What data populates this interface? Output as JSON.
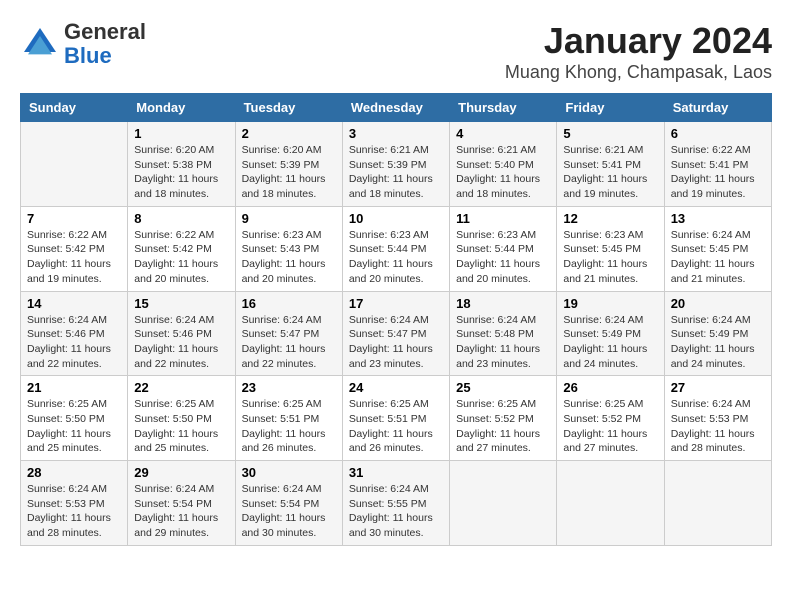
{
  "header": {
    "logo_general": "General",
    "logo_blue": "Blue",
    "title": "January 2024",
    "subtitle": "Muang Khong, Champasak, Laos"
  },
  "columns": [
    "Sunday",
    "Monday",
    "Tuesday",
    "Wednesday",
    "Thursday",
    "Friday",
    "Saturday"
  ],
  "weeks": [
    [
      {
        "day": "",
        "sunrise": "",
        "sunset": "",
        "daylight": ""
      },
      {
        "day": "1",
        "sunrise": "Sunrise: 6:20 AM",
        "sunset": "Sunset: 5:38 PM",
        "daylight": "Daylight: 11 hours and 18 minutes."
      },
      {
        "day": "2",
        "sunrise": "Sunrise: 6:20 AM",
        "sunset": "Sunset: 5:39 PM",
        "daylight": "Daylight: 11 hours and 18 minutes."
      },
      {
        "day": "3",
        "sunrise": "Sunrise: 6:21 AM",
        "sunset": "Sunset: 5:39 PM",
        "daylight": "Daylight: 11 hours and 18 minutes."
      },
      {
        "day": "4",
        "sunrise": "Sunrise: 6:21 AM",
        "sunset": "Sunset: 5:40 PM",
        "daylight": "Daylight: 11 hours and 18 minutes."
      },
      {
        "day": "5",
        "sunrise": "Sunrise: 6:21 AM",
        "sunset": "Sunset: 5:41 PM",
        "daylight": "Daylight: 11 hours and 19 minutes."
      },
      {
        "day": "6",
        "sunrise": "Sunrise: 6:22 AM",
        "sunset": "Sunset: 5:41 PM",
        "daylight": "Daylight: 11 hours and 19 minutes."
      }
    ],
    [
      {
        "day": "7",
        "sunrise": "Sunrise: 6:22 AM",
        "sunset": "Sunset: 5:42 PM",
        "daylight": "Daylight: 11 hours and 19 minutes."
      },
      {
        "day": "8",
        "sunrise": "Sunrise: 6:22 AM",
        "sunset": "Sunset: 5:42 PM",
        "daylight": "Daylight: 11 hours and 20 minutes."
      },
      {
        "day": "9",
        "sunrise": "Sunrise: 6:23 AM",
        "sunset": "Sunset: 5:43 PM",
        "daylight": "Daylight: 11 hours and 20 minutes."
      },
      {
        "day": "10",
        "sunrise": "Sunrise: 6:23 AM",
        "sunset": "Sunset: 5:44 PM",
        "daylight": "Daylight: 11 hours and 20 minutes."
      },
      {
        "day": "11",
        "sunrise": "Sunrise: 6:23 AM",
        "sunset": "Sunset: 5:44 PM",
        "daylight": "Daylight: 11 hours and 20 minutes."
      },
      {
        "day": "12",
        "sunrise": "Sunrise: 6:23 AM",
        "sunset": "Sunset: 5:45 PM",
        "daylight": "Daylight: 11 hours and 21 minutes."
      },
      {
        "day": "13",
        "sunrise": "Sunrise: 6:24 AM",
        "sunset": "Sunset: 5:45 PM",
        "daylight": "Daylight: 11 hours and 21 minutes."
      }
    ],
    [
      {
        "day": "14",
        "sunrise": "Sunrise: 6:24 AM",
        "sunset": "Sunset: 5:46 PM",
        "daylight": "Daylight: 11 hours and 22 minutes."
      },
      {
        "day": "15",
        "sunrise": "Sunrise: 6:24 AM",
        "sunset": "Sunset: 5:46 PM",
        "daylight": "Daylight: 11 hours and 22 minutes."
      },
      {
        "day": "16",
        "sunrise": "Sunrise: 6:24 AM",
        "sunset": "Sunset: 5:47 PM",
        "daylight": "Daylight: 11 hours and 22 minutes."
      },
      {
        "day": "17",
        "sunrise": "Sunrise: 6:24 AM",
        "sunset": "Sunset: 5:47 PM",
        "daylight": "Daylight: 11 hours and 23 minutes."
      },
      {
        "day": "18",
        "sunrise": "Sunrise: 6:24 AM",
        "sunset": "Sunset: 5:48 PM",
        "daylight": "Daylight: 11 hours and 23 minutes."
      },
      {
        "day": "19",
        "sunrise": "Sunrise: 6:24 AM",
        "sunset": "Sunset: 5:49 PM",
        "daylight": "Daylight: 11 hours and 24 minutes."
      },
      {
        "day": "20",
        "sunrise": "Sunrise: 6:24 AM",
        "sunset": "Sunset: 5:49 PM",
        "daylight": "Daylight: 11 hours and 24 minutes."
      }
    ],
    [
      {
        "day": "21",
        "sunrise": "Sunrise: 6:25 AM",
        "sunset": "Sunset: 5:50 PM",
        "daylight": "Daylight: 11 hours and 25 minutes."
      },
      {
        "day": "22",
        "sunrise": "Sunrise: 6:25 AM",
        "sunset": "Sunset: 5:50 PM",
        "daylight": "Daylight: 11 hours and 25 minutes."
      },
      {
        "day": "23",
        "sunrise": "Sunrise: 6:25 AM",
        "sunset": "Sunset: 5:51 PM",
        "daylight": "Daylight: 11 hours and 26 minutes."
      },
      {
        "day": "24",
        "sunrise": "Sunrise: 6:25 AM",
        "sunset": "Sunset: 5:51 PM",
        "daylight": "Daylight: 11 hours and 26 minutes."
      },
      {
        "day": "25",
        "sunrise": "Sunrise: 6:25 AM",
        "sunset": "Sunset: 5:52 PM",
        "daylight": "Daylight: 11 hours and 27 minutes."
      },
      {
        "day": "26",
        "sunrise": "Sunrise: 6:25 AM",
        "sunset": "Sunset: 5:52 PM",
        "daylight": "Daylight: 11 hours and 27 minutes."
      },
      {
        "day": "27",
        "sunrise": "Sunrise: 6:24 AM",
        "sunset": "Sunset: 5:53 PM",
        "daylight": "Daylight: 11 hours and 28 minutes."
      }
    ],
    [
      {
        "day": "28",
        "sunrise": "Sunrise: 6:24 AM",
        "sunset": "Sunset: 5:53 PM",
        "daylight": "Daylight: 11 hours and 28 minutes."
      },
      {
        "day": "29",
        "sunrise": "Sunrise: 6:24 AM",
        "sunset": "Sunset: 5:54 PM",
        "daylight": "Daylight: 11 hours and 29 minutes."
      },
      {
        "day": "30",
        "sunrise": "Sunrise: 6:24 AM",
        "sunset": "Sunset: 5:54 PM",
        "daylight": "Daylight: 11 hours and 30 minutes."
      },
      {
        "day": "31",
        "sunrise": "Sunrise: 6:24 AM",
        "sunset": "Sunset: 5:55 PM",
        "daylight": "Daylight: 11 hours and 30 minutes."
      },
      {
        "day": "",
        "sunrise": "",
        "sunset": "",
        "daylight": ""
      },
      {
        "day": "",
        "sunrise": "",
        "sunset": "",
        "daylight": ""
      },
      {
        "day": "",
        "sunrise": "",
        "sunset": "",
        "daylight": ""
      }
    ]
  ]
}
